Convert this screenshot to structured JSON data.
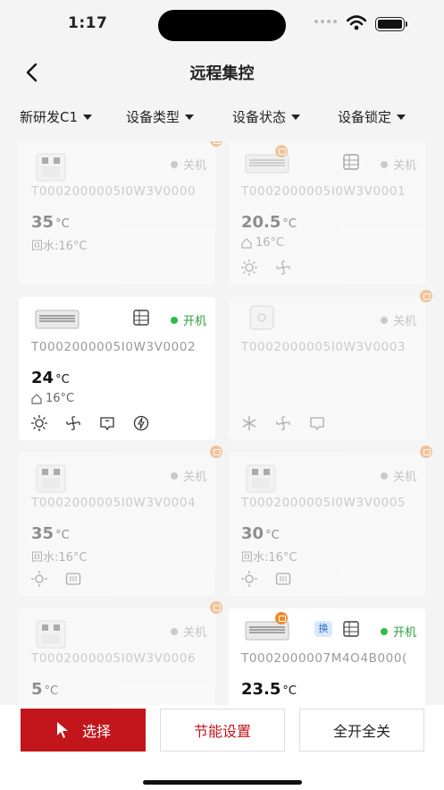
{
  "status_bar": {
    "time": "1:17"
  },
  "nav": {
    "title": "远程集控"
  },
  "filters": [
    {
      "label": "新研发C1"
    },
    {
      "label": "设备类型"
    },
    {
      "label": "设备状态"
    },
    {
      "label": "设备锁定"
    }
  ],
  "devices": [
    {
      "id": "T0002000005I0W3V0000",
      "status": "关机",
      "temp": "35",
      "unit": "°C",
      "sub": "回水:16°C",
      "type": "heat-pump"
    },
    {
      "id": "T0002000005I0W3V0001",
      "status": "关机",
      "temp": "20.5",
      "unit": "°C",
      "sub": "16°C",
      "type": "ac-unit"
    },
    {
      "id": "T0002000005I0W3V0002",
      "status": "开机",
      "temp": "24",
      "unit": "°C",
      "sub": "16°C",
      "type": "ac-unit"
    },
    {
      "id": "T0002000005I0W3V0003",
      "status": "关机",
      "temp": "",
      "unit": "",
      "sub": "",
      "type": "thermostat"
    },
    {
      "id": "T0002000005I0W3V0004",
      "status": "关机",
      "temp": "35",
      "unit": "°C",
      "sub": "回水:16°C",
      "type": "heat-pump"
    },
    {
      "id": "T0002000005I0W3V0005",
      "status": "关机",
      "temp": "30",
      "unit": "°C",
      "sub": "回水:16°C",
      "type": "heat-pump"
    },
    {
      "id": "T0002000005I0W3V0006",
      "status": "关机",
      "temp": "5",
      "unit": "°C",
      "sub": "",
      "type": "heat-pump"
    },
    {
      "id": "T0002000007M4O4B000(",
      "status": "开机",
      "temp": "23.5",
      "unit": "°C",
      "sub": "",
      "type": "ac-unit",
      "swap_label": "换"
    }
  ],
  "bottom_bar": {
    "select_label": "选择",
    "energy_label": "节能设置",
    "all_label": "全开全关"
  },
  "colors": {
    "primary": "#c2161c",
    "on": "#2fbb48",
    "badge": "#f08a2e"
  }
}
